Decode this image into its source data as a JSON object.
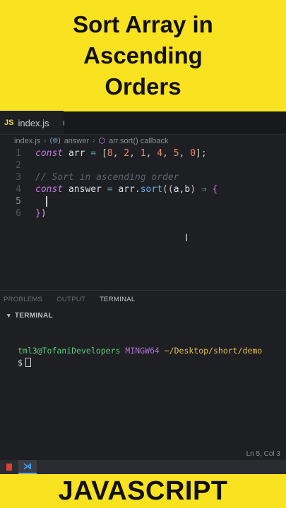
{
  "banner": {
    "title_lines": [
      "Sort Array in",
      "Ascending",
      "Orders"
    ],
    "footer": "JAVASCRIPT",
    "background": "#f9e21f"
  },
  "editor": {
    "tab": {
      "badge": "JS",
      "filename": "index.js"
    },
    "breadcrumb": {
      "file": "index.js",
      "symbol1_icon": "(⊚)",
      "symbol1": "answer",
      "symbol2": "arr.sort() callback"
    },
    "lines": [
      {
        "n": "1",
        "text": "const arr = [8, 2, 1, 4, 5, 0];"
      },
      {
        "n": "2",
        "text": ""
      },
      {
        "n": "3",
        "text": "// Sort in ascending order"
      },
      {
        "n": "4",
        "text": "const answer = arr.sort((a,b) ⇒ {"
      },
      {
        "n": "5",
        "text": ""
      },
      {
        "n": "6",
        "text": "})"
      }
    ]
  },
  "panel": {
    "tabs": [
      "PROBLEMS",
      "OUTPUT",
      "TERMINAL"
    ],
    "active_tab": "TERMINAL",
    "header": "TERMINAL",
    "prompt": {
      "user": "tml3@TofaniDevelopers",
      "host": "MINGW64",
      "path": "~/Desktop/short/demo",
      "symbol": "$"
    }
  },
  "status": {
    "position": "Ln 5, Col 3"
  }
}
